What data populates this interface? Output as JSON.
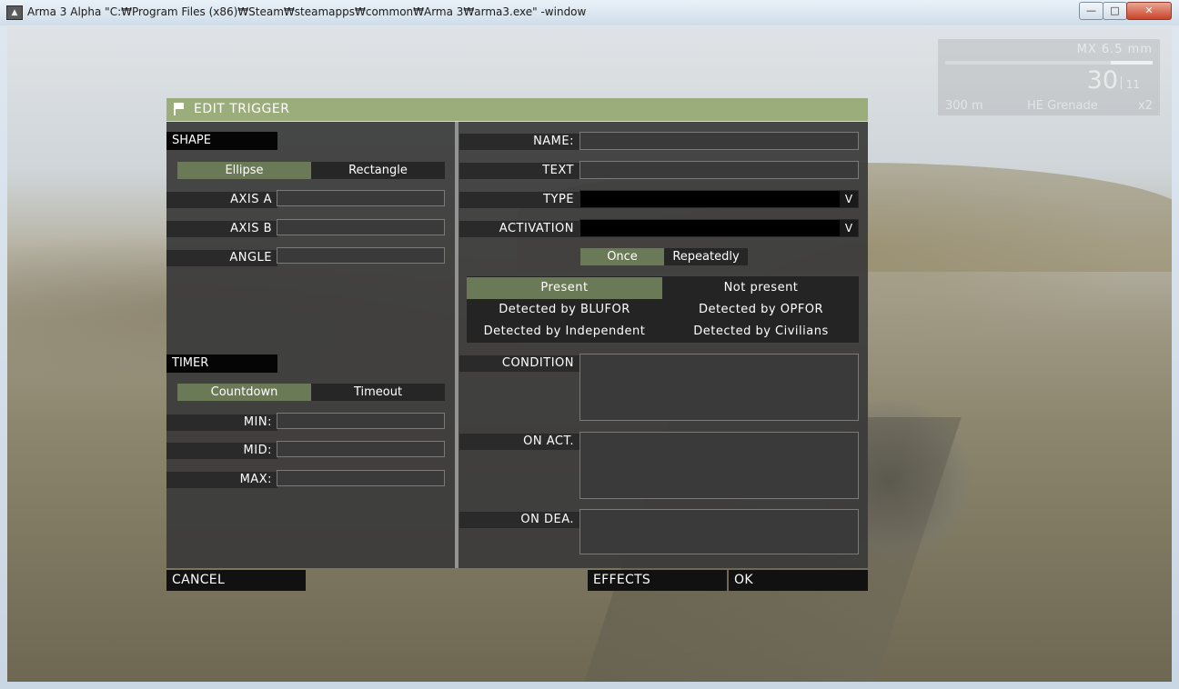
{
  "window": {
    "title": "Arma 3 Alpha \"C:₩Program Files (x86)₩Steam₩steamapps₩common₩Arma 3₩arma3.exe\" -window",
    "app_icon": "arma-icon",
    "minimize": "—",
    "maximize": "□",
    "close": "✕"
  },
  "hud": {
    "weapon": "MX 6.5 mm",
    "ammo": "30",
    "magazines": "11",
    "range": "300 m",
    "grenade": "HE Grenade",
    "grenade_count": "x2",
    "ammo_fraction": 0.2
  },
  "dialog": {
    "title": "EDIT TRIGGER",
    "header_color": "#9aad7b",
    "active_color": "#6b7a56",
    "shape": {
      "section": "SHAPE",
      "options": [
        "Ellipse",
        "Rectangle"
      ],
      "selected": "Ellipse",
      "axis_a_label": "AXIS A",
      "axis_b_label": "AXIS B",
      "angle_label": "ANGLE",
      "axis_a": "",
      "axis_b": "",
      "angle": ""
    },
    "timer": {
      "section": "TIMER",
      "options": [
        "Countdown",
        "Timeout"
      ],
      "selected": "Countdown",
      "min_label": "MIN:",
      "mid_label": "MID:",
      "max_label": "MAX:",
      "min": "",
      "mid": "",
      "max": ""
    },
    "details": {
      "name_label": "NAME:",
      "text_label": "TEXT",
      "type_label": "TYPE",
      "activation_label": "ACTIVATION",
      "name": "",
      "text": "",
      "type": "",
      "activation": "",
      "dropdown_arrow": "V",
      "repeat_options": [
        "Once",
        "Repeatedly"
      ],
      "repeat_selected": "Once",
      "presence_options": [
        "Present",
        "Not present",
        "Detected by BLUFOR",
        "Detected by OPFOR",
        "Detected by Independent",
        "Detected by Civilians"
      ],
      "presence_selected": "Present",
      "condition_label": "CONDITION",
      "on_act_label": "ON ACT.",
      "on_dea_label": "ON DEA.",
      "condition": "",
      "on_act": "",
      "on_dea": ""
    },
    "buttons": {
      "cancel": "CANCEL",
      "effects": "EFFECTS",
      "ok": "OK"
    }
  }
}
